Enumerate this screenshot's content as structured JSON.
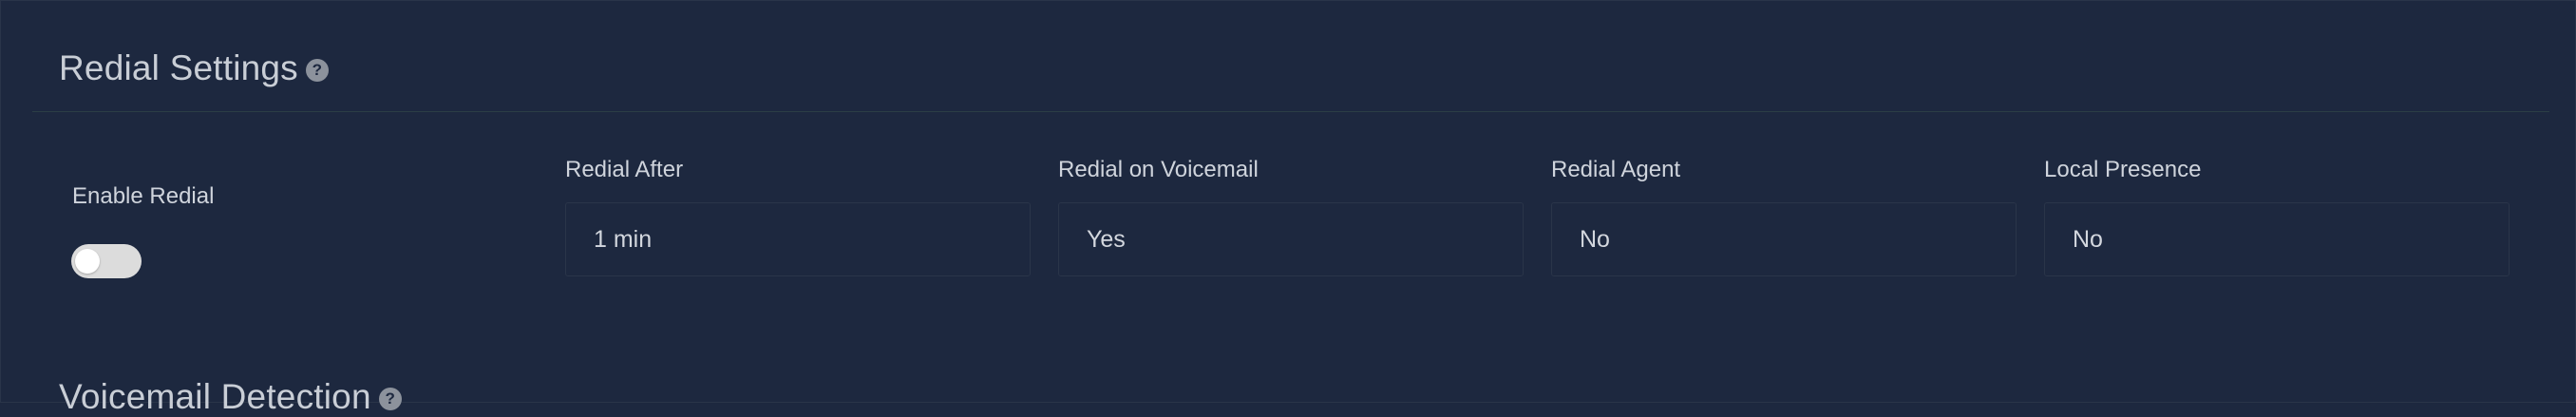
{
  "redial_settings": {
    "title": "Redial Settings",
    "help_icon": "question-circle-icon",
    "enable_redial": {
      "label": "Enable Redial",
      "enabled": false
    },
    "fields": [
      {
        "label": "Redial After",
        "value": "1 min"
      },
      {
        "label": "Redial on Voicemail",
        "value": "Yes"
      },
      {
        "label": "Redial Agent",
        "value": "No"
      },
      {
        "label": "Local Presence",
        "value": "No"
      }
    ]
  },
  "voicemail_detection": {
    "title": "Voicemail Detection",
    "help_icon": "question-circle-icon"
  },
  "colors": {
    "background": "#1d283f",
    "toggle_off": "#dcdcdc",
    "text": "#cfd4dc"
  }
}
